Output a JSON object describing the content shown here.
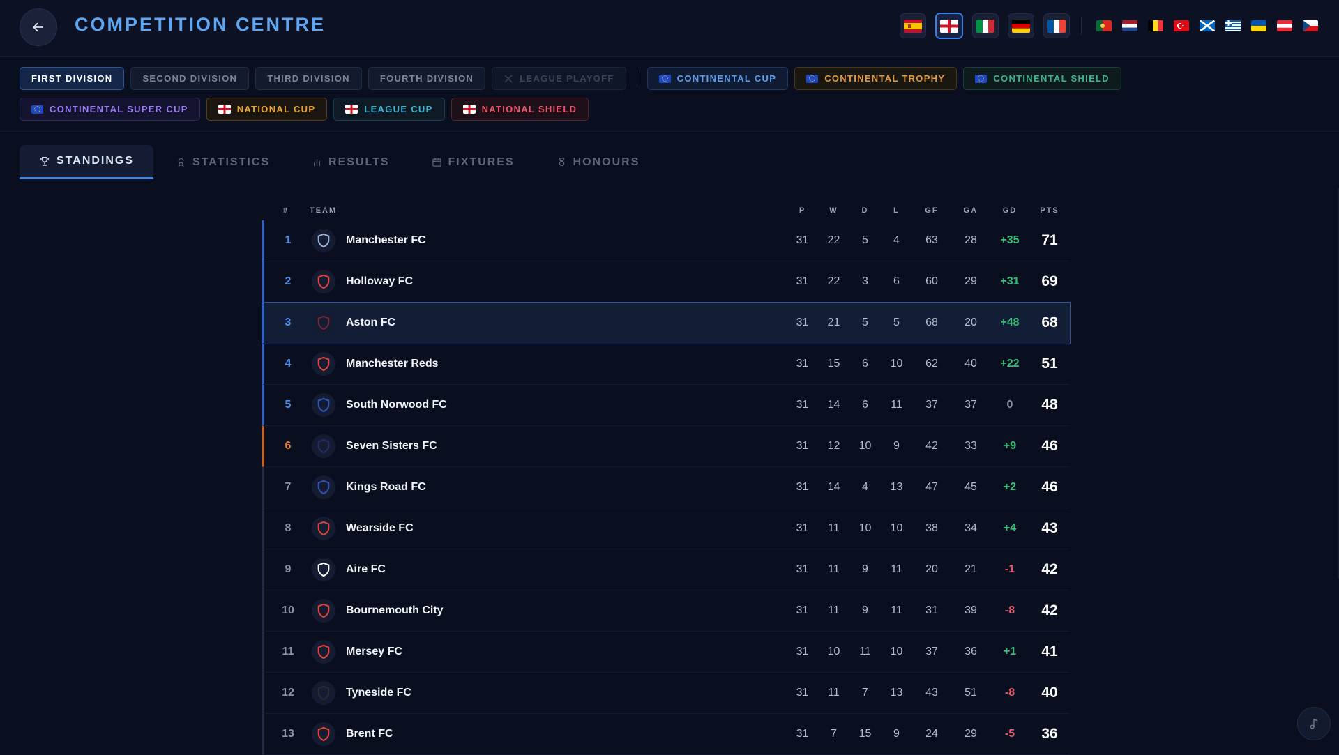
{
  "header": {
    "title": "COMPETITION CENTRE",
    "big_flags": [
      "spain",
      "england",
      "italy",
      "germany",
      "france"
    ],
    "small_flags": [
      "portugal",
      "netherlands",
      "belgium",
      "turkey",
      "scotland",
      "greece",
      "ukraine",
      "austria",
      "czech-republic"
    ]
  },
  "competitions": {
    "row1": [
      {
        "label": "FIRST DIVISION",
        "style": "active"
      },
      {
        "label": "SECOND DIVISION",
        "style": "plain"
      },
      {
        "label": "THIRD DIVISION",
        "style": "plain"
      },
      {
        "label": "FOURTH DIVISION",
        "style": "plain"
      },
      {
        "label": "LEAGUE PLAYOFF",
        "style": "disabled"
      },
      {
        "label": "CONTINENTAL CUP",
        "style": "blue"
      },
      {
        "label": "CONTINENTAL TROPHY",
        "style": "orange"
      },
      {
        "label": "CONTINENTAL SHIELD",
        "style": "teal"
      }
    ],
    "row2": [
      {
        "label": "CONTINENTAL SUPER CUP",
        "style": "purple"
      },
      {
        "label": "NATIONAL CUP",
        "style": "gold"
      },
      {
        "label": "LEAGUE CUP",
        "style": "cyan"
      },
      {
        "label": "NATIONAL SHIELD",
        "style": "red"
      }
    ]
  },
  "tabs": [
    {
      "label": "STANDINGS",
      "icon": "trophy-icon"
    },
    {
      "label": "STATISTICS",
      "icon": "award-icon"
    },
    {
      "label": "RESULTS",
      "icon": "bar-chart-icon"
    },
    {
      "label": "FIXTURES",
      "icon": "calendar-icon"
    },
    {
      "label": "HONOURS",
      "icon": "medal-icon"
    }
  ],
  "table": {
    "headers": {
      "pos": "#",
      "team": "TEAM",
      "p": "P",
      "w": "W",
      "d": "D",
      "l": "L",
      "gf": "GF",
      "ga": "GA",
      "gd": "GD",
      "pts": "PTS"
    },
    "rows": [
      {
        "pos": "1",
        "team": "Manchester FC",
        "p": "31",
        "w": "22",
        "d": "5",
        "l": "4",
        "gf": "63",
        "ga": "28",
        "gd": "+35",
        "pts": "71",
        "zone": "blue",
        "badge_color": "#9fb4d8"
      },
      {
        "pos": "2",
        "team": "Holloway FC",
        "p": "31",
        "w": "22",
        "d": "3",
        "l": "6",
        "gf": "60",
        "ga": "29",
        "gd": "+31",
        "pts": "69",
        "zone": "blue",
        "badge_color": "#e0433c"
      },
      {
        "pos": "3",
        "team": "Aston FC",
        "p": "31",
        "w": "21",
        "d": "5",
        "l": "5",
        "gf": "68",
        "ga": "20",
        "gd": "+48",
        "pts": "68",
        "zone": "blue",
        "badge_color": "#6e2738"
      },
      {
        "pos": "4",
        "team": "Manchester Reds",
        "p": "31",
        "w": "15",
        "d": "6",
        "l": "10",
        "gf": "62",
        "ga": "40",
        "gd": "+22",
        "pts": "51",
        "zone": "blue",
        "badge_color": "#e0433c"
      },
      {
        "pos": "5",
        "team": "South Norwood FC",
        "p": "31",
        "w": "14",
        "d": "6",
        "l": "11",
        "gf": "37",
        "ga": "37",
        "gd": "0",
        "pts": "48",
        "zone": "blue",
        "badge_color": "#2d56b8"
      },
      {
        "pos": "6",
        "team": "Seven Sisters FC",
        "p": "31",
        "w": "12",
        "d": "10",
        "l": "9",
        "gf": "42",
        "ga": "33",
        "gd": "+9",
        "pts": "46",
        "zone": "orange",
        "badge_color": "#1f2f66"
      },
      {
        "pos": "7",
        "team": "Kings Road FC",
        "p": "31",
        "w": "14",
        "d": "4",
        "l": "13",
        "gf": "47",
        "ga": "45",
        "gd": "+2",
        "pts": "46",
        "zone": "none",
        "badge_color": "#2d56b8"
      },
      {
        "pos": "8",
        "team": "Wearside FC",
        "p": "31",
        "w": "11",
        "d": "10",
        "l": "10",
        "gf": "38",
        "ga": "34",
        "gd": "+4",
        "pts": "43",
        "zone": "none",
        "badge_color": "#e0433c"
      },
      {
        "pos": "9",
        "team": "Aire FC",
        "p": "31",
        "w": "11",
        "d": "9",
        "l": "11",
        "gf": "20",
        "ga": "21",
        "gd": "-1",
        "pts": "42",
        "zone": "none",
        "badge_color": "#ffffff"
      },
      {
        "pos": "10",
        "team": "Bournemouth City",
        "p": "31",
        "w": "11",
        "d": "9",
        "l": "11",
        "gf": "31",
        "ga": "39",
        "gd": "-8",
        "pts": "42",
        "zone": "none",
        "badge_color": "#e0433c"
      },
      {
        "pos": "11",
        "team": "Mersey FC",
        "p": "31",
        "w": "10",
        "d": "11",
        "l": "10",
        "gf": "37",
        "ga": "36",
        "gd": "+1",
        "pts": "41",
        "zone": "none",
        "badge_color": "#e0433c"
      },
      {
        "pos": "12",
        "team": "Tyneside FC",
        "p": "31",
        "w": "11",
        "d": "7",
        "l": "13",
        "gf": "43",
        "ga": "51",
        "gd": "-8",
        "pts": "40",
        "zone": "none",
        "badge_color": "#2b2a2e"
      },
      {
        "pos": "13",
        "team": "Brent FC",
        "p": "31",
        "w": "7",
        "d": "15",
        "l": "9",
        "gf": "24",
        "ga": "29",
        "gd": "-5",
        "pts": "36",
        "zone": "none",
        "badge_color": "#e0433c"
      }
    ],
    "selected_row": "3"
  },
  "colors": {
    "accent": "#3d86ee",
    "title": "#5ea6f2",
    "positive": "#34c27a",
    "negative": "#e9556a"
  },
  "fab_icon": "music-note-icon"
}
